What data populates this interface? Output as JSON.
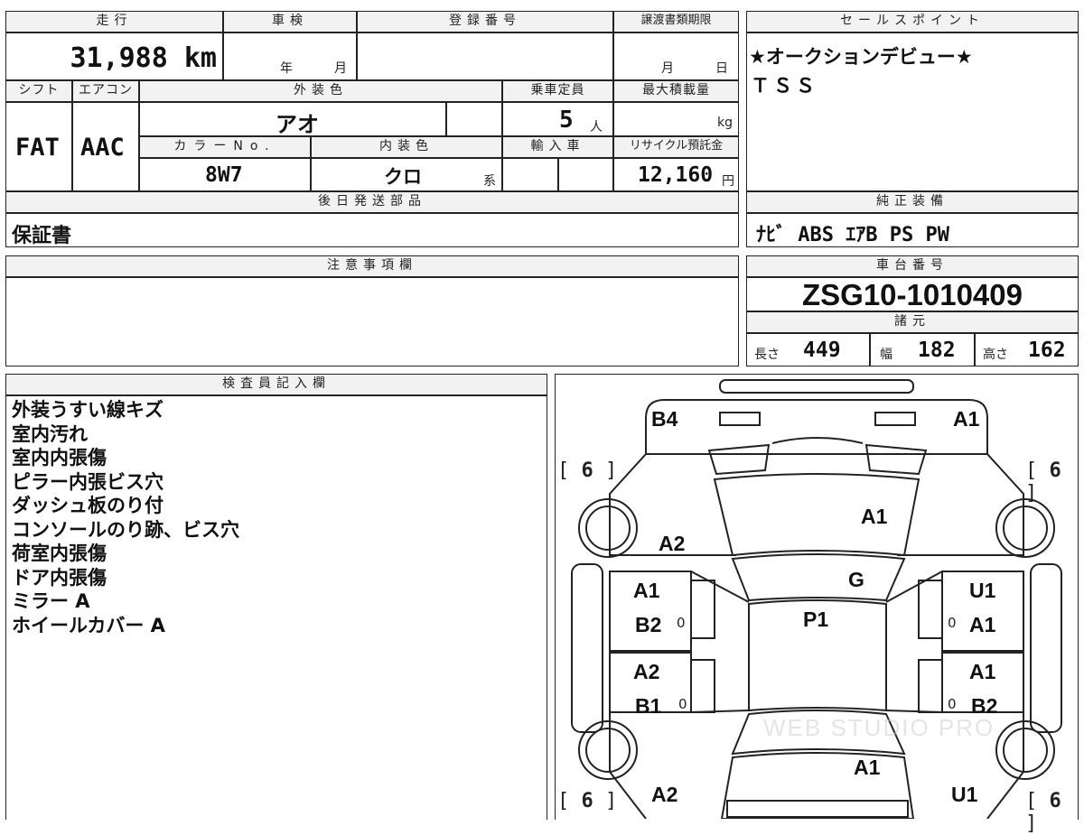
{
  "top_table": {
    "mileage_label": "走行",
    "mileage_value": "31,988 km",
    "inspection_label": "車検",
    "inspection_year_unit": "年",
    "inspection_month_unit": "月",
    "registration_label": "登録番号",
    "registration_value": "",
    "transfer_label": "譲渡書類期限",
    "transfer_month_unit": "月",
    "transfer_day_unit": "日",
    "shift_label": "シフト",
    "shift_value": "FAT",
    "aircon_label": "エアコン",
    "aircon_value": "AAC",
    "exterior_label": "外装色",
    "exterior_value": "アオ",
    "capacity_label": "乗車定員",
    "capacity_value": "5",
    "capacity_unit": "人",
    "maxload_label": "最大積載量",
    "maxload_unit": "kg",
    "color_no_label": "カラーNo.",
    "color_no_value": "8W7",
    "interior_label": "内装色",
    "interior_value": "クロ",
    "interior_suffix": "系",
    "import_label": "輸入車",
    "recycle_label": "リサイクル預託金",
    "recycle_value": "12,160",
    "recycle_unit": "円",
    "later_parts_label": "後日発送部品",
    "later_parts_value": "保証書"
  },
  "sales_point": {
    "label": "セールスポイント",
    "line1": "★オークションデビュー★",
    "line2": "ＴＳＳ"
  },
  "equipment": {
    "label": "純正装備",
    "value": "ﾅﾋﾞ ABS ｴｱB PS PW"
  },
  "notes": {
    "label": "注意事項欄",
    "value": ""
  },
  "chassis": {
    "label": "車台番号",
    "value": "ZSG10-1010409",
    "specs_label": "諸元",
    "length_label": "長さ",
    "length_value": "449",
    "width_label": "幅",
    "width_value": "182",
    "height_label": "高さ",
    "height_value": "162"
  },
  "inspector": {
    "label": "検査員記入欄",
    "lines": [
      "外装うすい線キズ",
      "室内汚れ",
      "室内内張傷",
      "ピラー内張ビス穴",
      "ダッシュ板のり付",
      "コンソールのり跡、ビス穴",
      "荷室内張傷",
      "ドア内張傷",
      "ミラー A",
      "ホイールカバー A"
    ]
  },
  "diagram": {
    "codes": {
      "rear_left": "B4",
      "rear_right": "A1",
      "rear_glass": "A1",
      "left_rear_fender": "A2",
      "roof_glass": "G",
      "roof": "P1",
      "left_rear_door_1": "A1",
      "left_rear_door_2": "B2",
      "right_rear_door_1": "U1",
      "right_rear_door_2": "A1",
      "left_front_door_1": "A2",
      "left_front_door_2": "B1",
      "right_front_door_1": "A1",
      "right_front_door_2": "B2",
      "hood": "A1",
      "left_front_fender": "A2",
      "right_front_fender": "U1"
    },
    "tire_tl": "6",
    "tire_tr": "6",
    "tire_bl": "6",
    "tire_br": "6",
    "zero": "0",
    "watermark": "WEB STUDIO PRO"
  }
}
